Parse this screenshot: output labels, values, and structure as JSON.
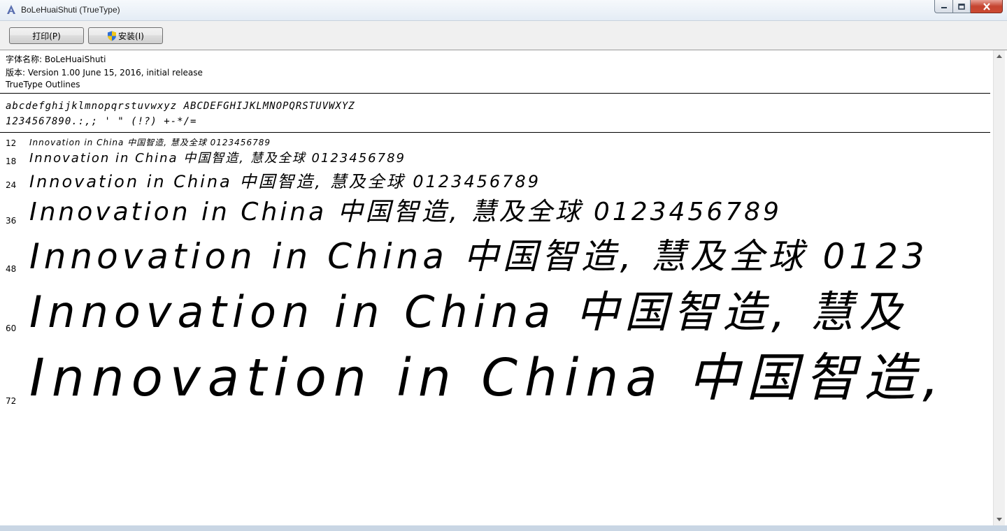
{
  "window": {
    "title": "BoLeHuaiShuti (TrueType)",
    "icon": "font-viewer-icon"
  },
  "toolbar": {
    "print_label": "打印(P)",
    "install_label": "安装(I)"
  },
  "info": {
    "font_name_line": "字体名称: BoLeHuaiShuti",
    "version_line": "版本: Version 1.00 June 15, 2016, initial release",
    "type_line": "TrueType Outlines"
  },
  "charset": {
    "letters": "abcdefghijklmnopqrstuvwxyz ABCDEFGHIJKLMNOPQRSTUVWXYZ",
    "digits_punct": "1234567890.:,; ' \" (!?) +-*/="
  },
  "samples": [
    {
      "size": "12",
      "text": "Innovation in China 中国智造, 慧及全球 0123456789"
    },
    {
      "size": "18",
      "text": "Innovation in China 中国智造, 慧及全球 0123456789"
    },
    {
      "size": "24",
      "text": "Innovation in China 中国智造, 慧及全球 0123456789"
    },
    {
      "size": "36",
      "text": "Innovation in China 中国智造, 慧及全球 0123456789"
    },
    {
      "size": "48",
      "text": "Innovation in China 中国智造, 慧及全球 0123"
    },
    {
      "size": "60",
      "text": "Innovation in China 中国智造, 慧及"
    },
    {
      "size": "72",
      "text": "Innovation in China 中国智造,"
    }
  ]
}
